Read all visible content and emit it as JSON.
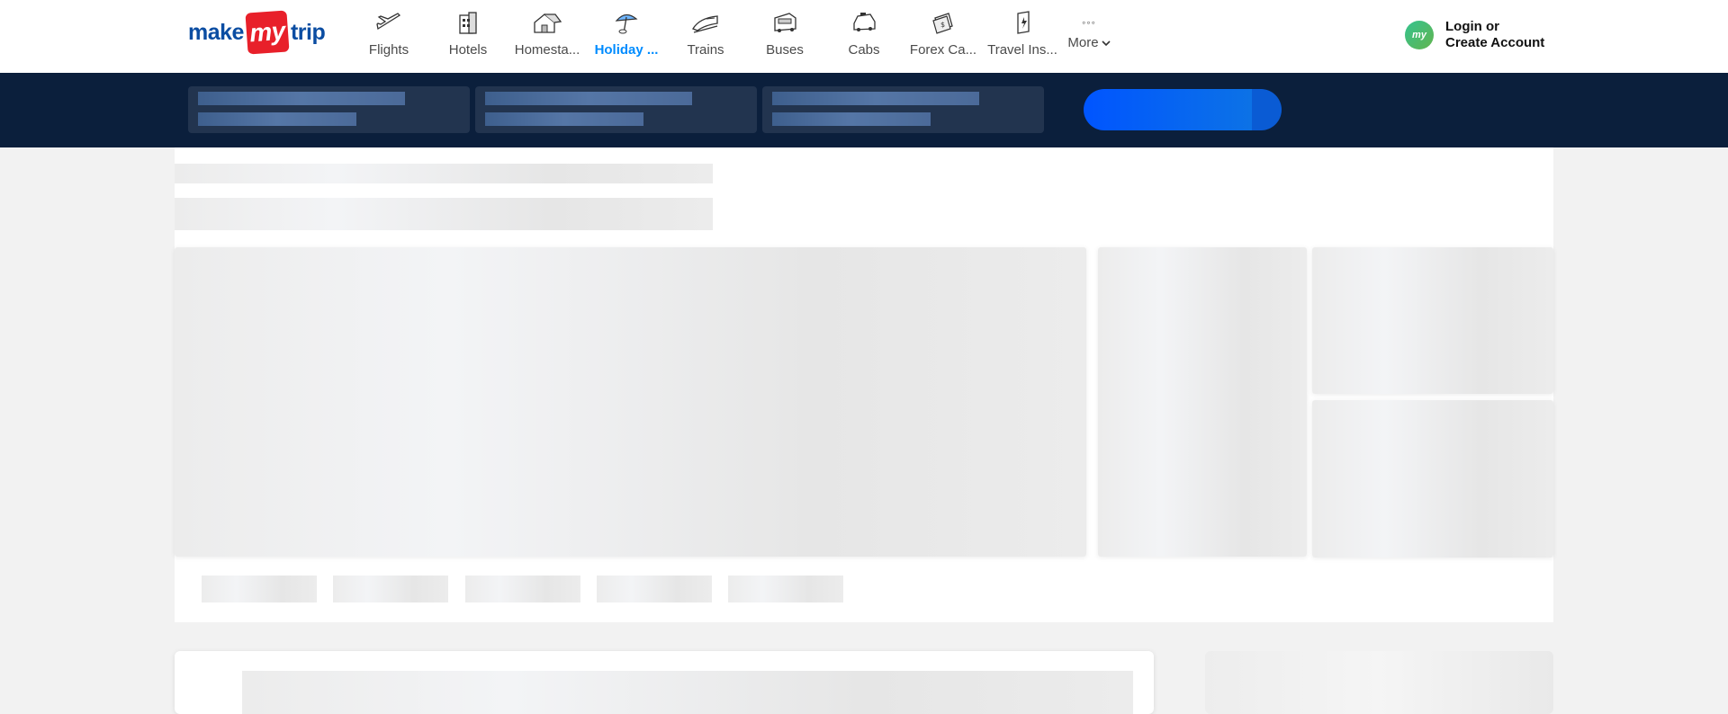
{
  "brand": {
    "logo_left": "make",
    "logo_mid": "my",
    "logo_right": "trip"
  },
  "nav": [
    {
      "label": "Flights",
      "icon": "plane-icon"
    },
    {
      "label": "Hotels",
      "icon": "hotel-icon"
    },
    {
      "label": "Homesta...",
      "icon": "homestay-icon"
    },
    {
      "label": "Holiday ...",
      "icon": "holiday-umbrella-icon",
      "active": true
    },
    {
      "label": "Trains",
      "icon": "train-icon"
    },
    {
      "label": "Buses",
      "icon": "bus-icon"
    },
    {
      "label": "Cabs",
      "icon": "cab-icon"
    },
    {
      "label": "Forex Ca...",
      "icon": "forex-card-icon"
    },
    {
      "label": "Travel Ins...",
      "icon": "travel-insurance-icon"
    }
  ],
  "more": {
    "label": "More",
    "dots": "◦◦◦"
  },
  "login": {
    "avatar": "my",
    "line1": "Login or",
    "line2": "Create Account"
  },
  "colors": {
    "brand_blue": "#0b4da2",
    "brand_red": "#e8202a",
    "active_blue": "#008cff",
    "band": "#0b1f3c",
    "button_blue": "#0055ff"
  }
}
